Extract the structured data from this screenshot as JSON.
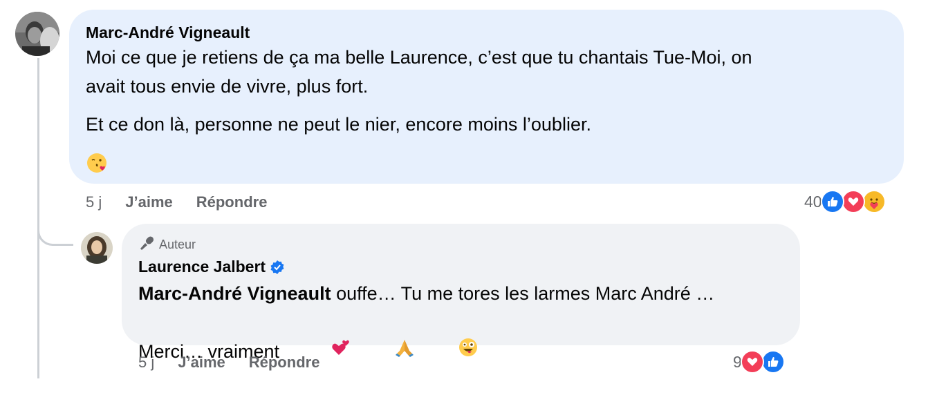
{
  "colors": {
    "accent": "#1877f2",
    "love": "#f33e58",
    "bubble": "#f0f2f5",
    "highlight": "#e7f0fd",
    "muted": "#65676b"
  },
  "comment": {
    "author": "Marc-André Vigneault",
    "paragraph1_line1": "Moi ce que je retiens de ça ma belle Laurence, c’est que tu chantais Tue-Moi, on",
    "paragraph1_line2": "avait tous envie de vivre, plus fort.",
    "paragraph2": "Et ce don là, personne ne peut le nier, encore moins l’oublier.",
    "emoji_icon": "kissing-face-heart-icon",
    "time": "5 j",
    "like_label": "J’aime",
    "reply_label": "Répondre",
    "reaction_count": "40",
    "reaction_icons": [
      "like-icon",
      "love-icon",
      "care-icon"
    ]
  },
  "reply": {
    "badge": "Auteur",
    "badge_icon": "microphone-icon",
    "author": "Laurence Jalbert",
    "verified_icon": "verified-badge-icon",
    "mention": "Marc-André Vigneault",
    "text_line1": " ouffe… Tu me tores les larmes Marc André …",
    "text_line2": "Merci… vraiment ",
    "emoji_icons": [
      "two-hearts-icon",
      "folded-hands-icon",
      "zany-face-icon"
    ],
    "time": "5 j",
    "like_label": "J’aime",
    "reply_label": "Répondre",
    "reaction_count": "9",
    "reaction_icons": [
      "love-icon",
      "like-icon"
    ]
  }
}
